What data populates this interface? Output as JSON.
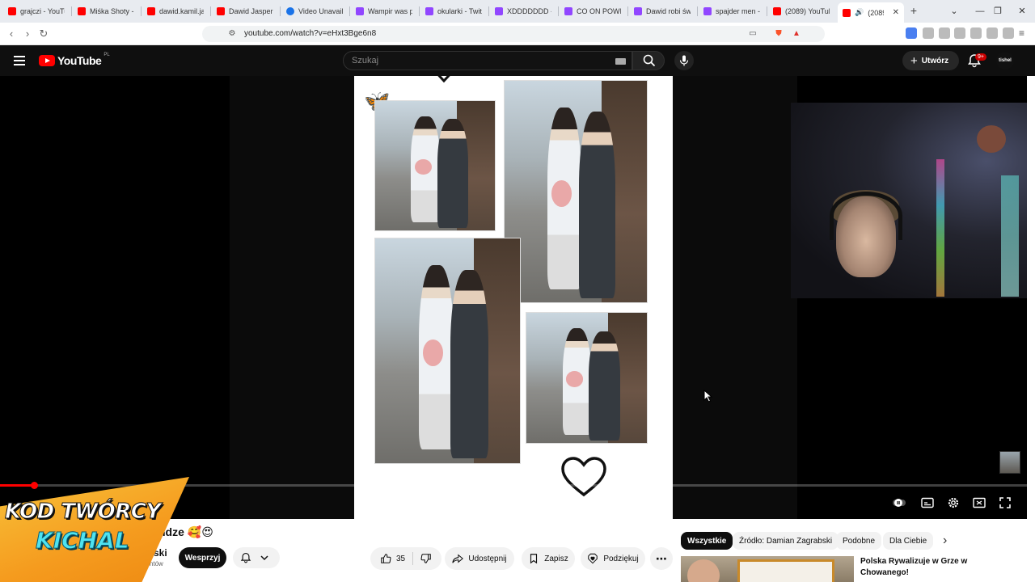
{
  "browser": {
    "tabs": [
      {
        "label": "grajczi - YouTu",
        "icon": "youtube-favicon",
        "kind": "yt"
      },
      {
        "label": "Miśka Shoty -",
        "icon": "youtube-favicon",
        "kind": "yt"
      },
      {
        "label": "dawid.kamil.ja",
        "icon": "youtube-favicon",
        "kind": "yt"
      },
      {
        "label": "Dawid Jasper",
        "icon": "youtube-favicon",
        "kind": "yt"
      },
      {
        "label": "Video Unavaila",
        "icon": "globe-favicon",
        "kind": "gen"
      },
      {
        "label": "Wampir was p",
        "icon": "twitch-favicon",
        "kind": "tw"
      },
      {
        "label": "okularki - Twit",
        "icon": "twitch-favicon",
        "kind": "tw"
      },
      {
        "label": "XDDDDDDD -",
        "icon": "twitch-favicon",
        "kind": "tw"
      },
      {
        "label": "CO ON POWIE",
        "icon": "twitch-favicon",
        "kind": "tw"
      },
      {
        "label": "Dawid robi św",
        "icon": "twitch-favicon",
        "kind": "tw"
      },
      {
        "label": "spajder men -",
        "icon": "twitch-favicon",
        "kind": "tw"
      },
      {
        "label": "(2089) YouTub",
        "icon": "youtube-favicon",
        "kind": "yt"
      }
    ],
    "active_tab": {
      "label": "(2089)",
      "close": "✕"
    },
    "new_tab": "+",
    "url": "youtube.com/watch?v=eHxt3Bge6n8"
  },
  "youtube": {
    "logo_text": "YouTube",
    "logo_country": "PL",
    "search_placeholder": "Szukaj",
    "create_label": "Utwórz",
    "notif_badge": "9+",
    "account_label": "tishel"
  },
  "video": {
    "title_visible": "Kindze 🥰😍",
    "channel_name_visible": "abski",
    "subscribers_visible": "2,28 tys. subskrybentów",
    "support_label": "Wesprzyj",
    "likes": "35",
    "share_label": "Udostępnij",
    "save_label": "Zapisz",
    "thanks_label": "Podziękuj",
    "progress_fraction": 0.033
  },
  "overlay": {
    "line1": "KOD TWÓRCY",
    "line2": "KICHAL"
  },
  "sidebar": {
    "chips": [
      "Wszystkie",
      "Źródło: Damian Zagrabski",
      "Podobne",
      "Dla Ciebie"
    ],
    "recommended": [
      {
        "title": "Polska Rywalizuje w Grze w Chowanego!"
      }
    ]
  },
  "colors": {
    "yt_red": "#ff0000",
    "twitch_purple": "#9146ff",
    "badge_orange": "#f59b1e",
    "badge_cyan": "#4fe3f0"
  }
}
